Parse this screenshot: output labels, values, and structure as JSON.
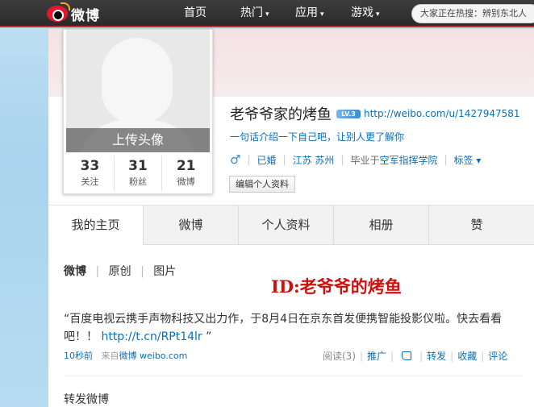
{
  "topbar": {
    "brand": "微博",
    "nav": [
      {
        "label": "首页",
        "caret": ""
      },
      {
        "label": "热门",
        "caret": "▾"
      },
      {
        "label": "应用",
        "caret": "▾"
      },
      {
        "label": "游戏",
        "caret": "▾"
      }
    ],
    "search_hint": "大家正在热搜：辨别东北人"
  },
  "avatar": {
    "upload_label": "上传头像",
    "stats": [
      {
        "value": "33",
        "label": "关注"
      },
      {
        "value": "31",
        "label": "粉丝"
      },
      {
        "value": "21",
        "label": "微博"
      }
    ]
  },
  "profile": {
    "name": "老爷爷家的烤鱼",
    "level_badge": "LV.3",
    "url": "http://weibo.com/u/1427947581",
    "intro": "一句话介绍一下自己吧，让别人更了解你",
    "gender_icon": "♂",
    "marital": "已婚",
    "location": "江苏 苏州",
    "school_prefix": "毕业于",
    "school": "空军指挥学院",
    "tags": "标签",
    "edit_button": "编辑个人资料"
  },
  "tabs": [
    "我的主页",
    "微博",
    "个人资料",
    "相册",
    "赞"
  ],
  "feed_filter": [
    "微博",
    "原创",
    "图片"
  ],
  "watermark": "ID:老爷爷的烤鱼",
  "post": {
    "text": "“百度电视云携手声物科技又出力作，于8月4日在京东首发便携智能投影仪啦。快去看看吧！！",
    "link": "http://t.cn/RPt14lr",
    "quote_end": " ”",
    "time": "10秒前",
    "source_prefix": "来自",
    "source": "微博 weibo.com",
    "actions": {
      "read": "阅读(3)",
      "promote": "推广",
      "repost": "转发",
      "favorite": "收藏",
      "comment": "评论"
    }
  },
  "repost_heading": "转发微博",
  "colors": {
    "accent": "#0a6fb8",
    "topbar": "#2f2f2f",
    "watermark": "#cc1111"
  }
}
